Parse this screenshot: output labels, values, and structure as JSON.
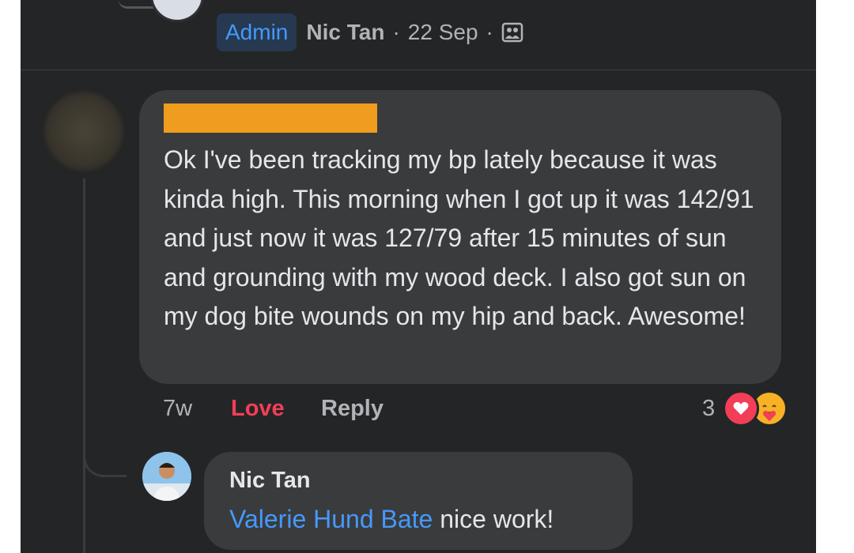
{
  "post_meta": {
    "badge": "Admin",
    "author": "Nic Tan",
    "separator": "·",
    "date": "22 Sep",
    "audience_icon": "group-icon"
  },
  "comment": {
    "text": "Ok I've been tracking my bp lately because it was kinda high. This morning when I got up it was 142/91 and just now it was 127/79 after 15 minutes of sun and grounding with my wood deck. I also got sun on my dog bite wounds on my hip and back. Awesome!",
    "time": "7w",
    "love_label": "Love",
    "reply_label": "Reply",
    "reaction_count": "3",
    "reaction_icons": [
      "love-reaction-icon",
      "care-reaction-icon"
    ]
  },
  "reply": {
    "author": "Nic Tan",
    "mention": "Valerie Hund Bate",
    "text": " nice work!"
  },
  "colors": {
    "background": "#242526",
    "bubble": "#3a3b3c",
    "accent_blue": "#4599ff",
    "love_red": "#f33e58",
    "redaction": "#f09c1e"
  }
}
